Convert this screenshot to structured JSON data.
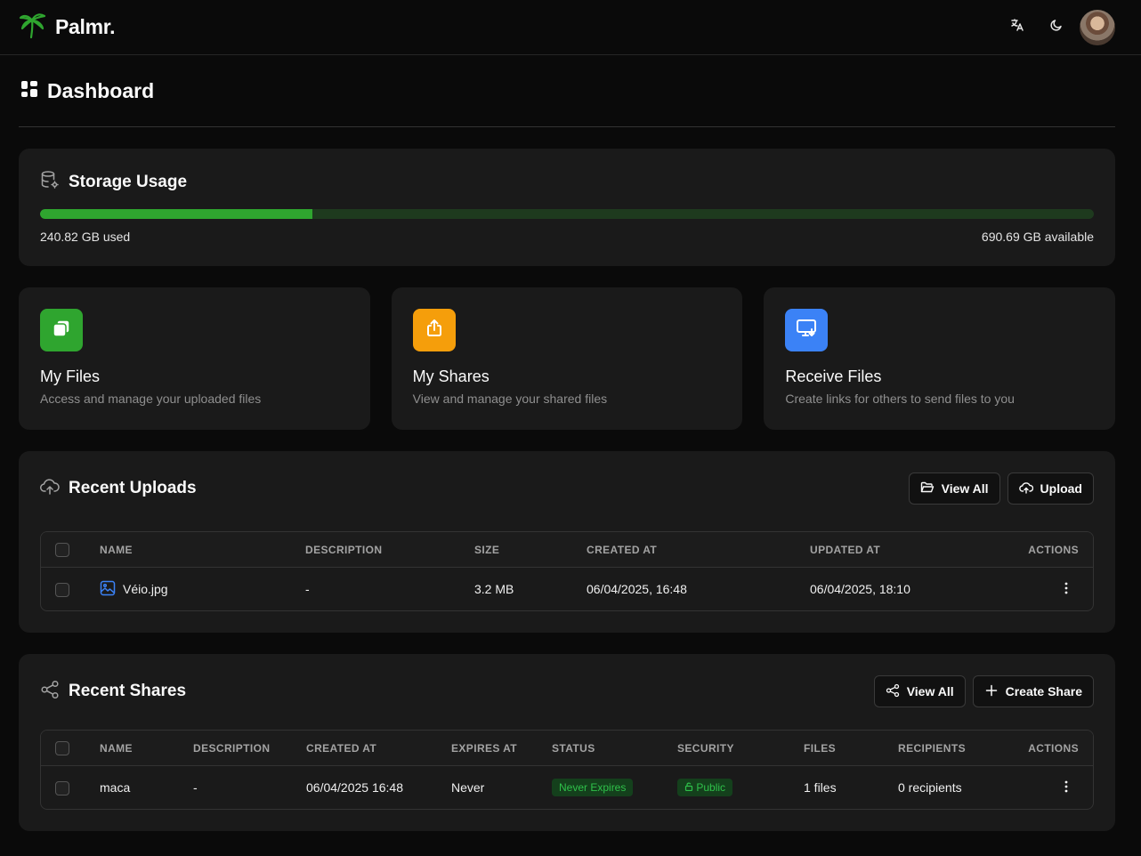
{
  "header": {
    "brand": "Palmr.",
    "avatar_alt": ""
  },
  "page": {
    "title": "Dashboard"
  },
  "storage": {
    "title": "Storage Usage",
    "used_label": "240.82 GB used",
    "available_label": "690.69 GB available",
    "used_fraction": 0.2586
  },
  "quick_actions": [
    {
      "title": "My Files",
      "desc": "Access and manage your uploaded files",
      "color": "#2fa52f"
    },
    {
      "title": "My Shares",
      "desc": "View and manage your shared files",
      "color": "#f59e0b"
    },
    {
      "title": "Receive Files",
      "desc": "Create links for others to send files to you",
      "color": "#3b82f6"
    }
  ],
  "uploads": {
    "title": "Recent Uploads",
    "view_all": "View All",
    "upload": "Upload",
    "columns": [
      "NAME",
      "DESCRIPTION",
      "SIZE",
      "CREATED AT",
      "UPDATED AT",
      "ACTIONS"
    ],
    "rows": [
      {
        "name": "Véio.jpg",
        "description": "-",
        "size": "3.2 MB",
        "created": "06/04/2025, 16:48",
        "updated": "06/04/2025, 18:10"
      }
    ]
  },
  "shares": {
    "title": "Recent Shares",
    "view_all": "View All",
    "create": "Create Share",
    "columns": [
      "NAME",
      "DESCRIPTION",
      "CREATED AT",
      "EXPIRES AT",
      "STATUS",
      "SECURITY",
      "FILES",
      "RECIPIENTS",
      "ACTIONS"
    ],
    "rows": [
      {
        "name": "maca",
        "description": "-",
        "created": "06/04/2025 16:48",
        "expires": "Never",
        "status": "Never Expires",
        "security": "Public",
        "files": "1 files",
        "recipients": "0 recipients"
      }
    ]
  },
  "colors": {
    "accent": "#2fa52f",
    "background": "#0a0a0a",
    "card": "#1a1a1a"
  }
}
